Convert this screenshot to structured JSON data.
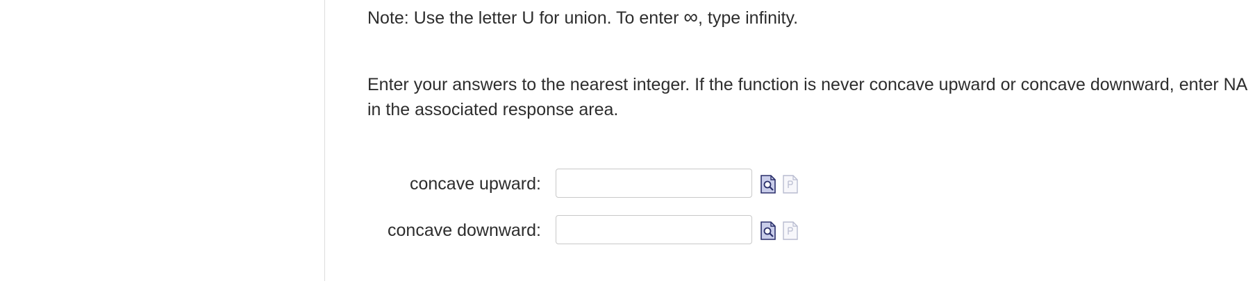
{
  "note": {
    "prefix": "Note: Use the letter U for union. To enter ",
    "symbol": "∞",
    "suffix": ", type infinity."
  },
  "instructions": "Enter your answers to the nearest integer. If the function is never concave upward or concave downward, enter NA in the associated response area.",
  "answers": [
    {
      "label": "concave upward:",
      "value": "",
      "preview_icon": "preview-magnifier-icon",
      "feedback_icon": "feedback-page-icon"
    },
    {
      "label": "concave downward:",
      "value": "",
      "preview_icon": "preview-magnifier-icon",
      "feedback_icon": "feedback-page-icon"
    }
  ],
  "colors": {
    "text": "#2d2d2d",
    "input_border": "#c8c8c8",
    "preview_icon_fill": "#c9cdea",
    "preview_icon_stroke": "#2a2f6b",
    "feedback_icon_stroke": "#b8bcd0"
  }
}
